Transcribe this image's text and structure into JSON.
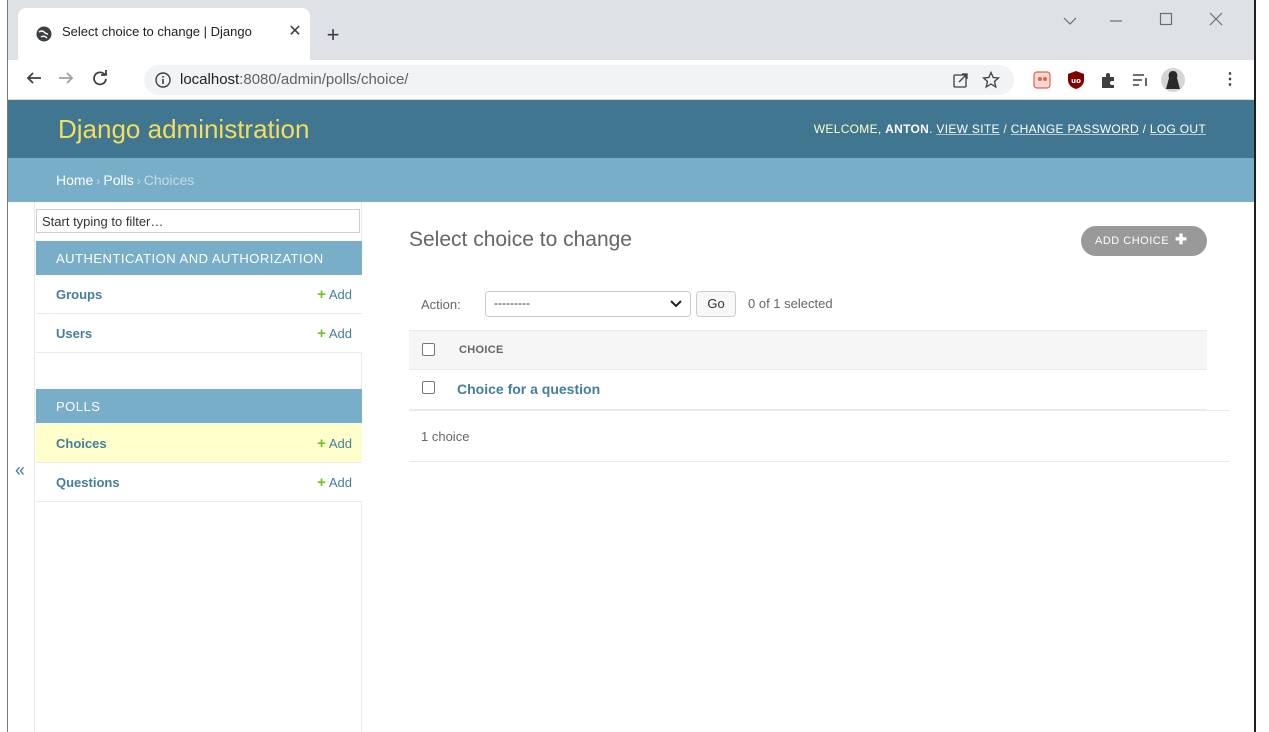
{
  "browser": {
    "tab_title": "Select choice to change | Django",
    "new_tab_glyph": "+",
    "close_glyph": "✕",
    "url_host": "localhost",
    "url_rest": ":8080/admin/polls/choice/",
    "icons": [
      "back-icon",
      "forward-icon",
      "reload-icon",
      "info-icon",
      "share-icon",
      "bookmark-star-icon",
      "extension-icon",
      "ublock-icon",
      "puzzle-icon",
      "reading-list-icon",
      "profile-avatar-icon",
      "menu-icon"
    ]
  },
  "admin": {
    "brand": "Django administration",
    "welcome": "WELCOME, ",
    "username": "ANTON",
    "view_site": "VIEW SITE",
    "change_password": "CHANGE PASSWORD",
    "log_out": "LOG OUT",
    "sep": " / "
  },
  "breadcrumbs": {
    "home": "Home",
    "app": "Polls",
    "current": "Choices",
    "arrow": "›"
  },
  "sidebar": {
    "collapse_glyph": "«",
    "filter_placeholder": "Start typing to filter…",
    "apps": [
      {
        "caption": "AUTHENTICATION AND AUTHORIZATION",
        "models": [
          {
            "name": "Groups",
            "add": "Add"
          },
          {
            "name": "Users",
            "add": "Add"
          }
        ]
      },
      {
        "caption": "POLLS",
        "models": [
          {
            "name": "Choices",
            "add": "Add",
            "current": true
          },
          {
            "name": "Questions",
            "add": "Add"
          }
        ]
      }
    ]
  },
  "content": {
    "title": "Select choice to change",
    "add_button": "ADD CHOICE",
    "action_label": "Action:",
    "action_selected": "---------",
    "go_label": "Go",
    "selected_count": "0 of 1 selected",
    "column_header": "CHOICE",
    "rows": [
      "Choice for a question"
    ],
    "paginator": "1 choice"
  },
  "colors": {
    "header": "#417690",
    "breadcrumbs": "#79aec8",
    "brand": "#f5dd5d",
    "link": "#447e9b",
    "add_plus": "#70bf2b",
    "current_row": "#ffffcc"
  }
}
